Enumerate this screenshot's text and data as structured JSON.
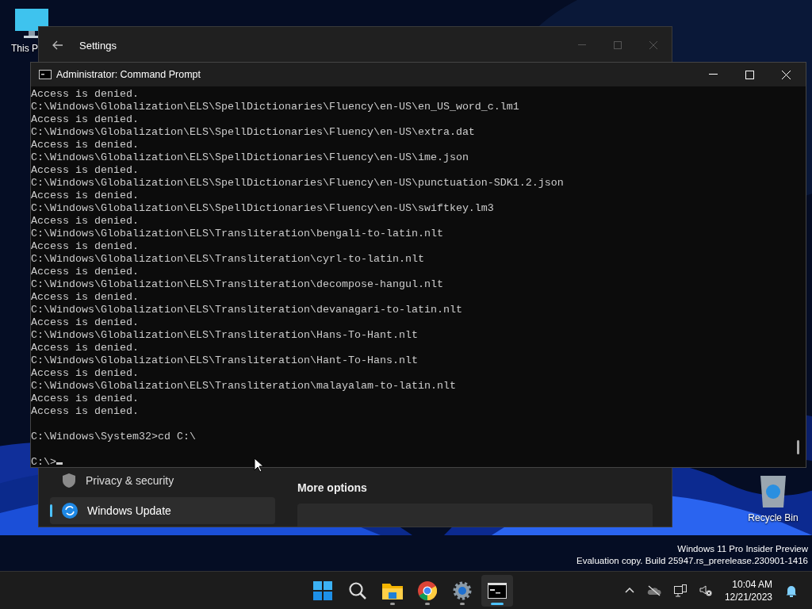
{
  "desktop_icons": [
    {
      "kind": "computer",
      "label": "This P"
    },
    {
      "kind": "recycle",
      "label": "Recycle Bin"
    }
  ],
  "settings_window": {
    "title": "Settings",
    "nav": [
      {
        "label": "Privacy & security",
        "kind": "shield",
        "selected": false
      },
      {
        "label": "Windows Update",
        "kind": "update",
        "selected": true
      }
    ],
    "section_heading": "More options"
  },
  "console_window": {
    "title": "Administrator: Command Prompt",
    "lines": [
      "Access is denied.",
      "C:\\Windows\\Globalization\\ELS\\SpellDictionaries\\Fluency\\en-US\\en_US_word_c.lm1",
      "Access is denied.",
      "C:\\Windows\\Globalization\\ELS\\SpellDictionaries\\Fluency\\en-US\\extra.dat",
      "Access is denied.",
      "C:\\Windows\\Globalization\\ELS\\SpellDictionaries\\Fluency\\en-US\\ime.json",
      "Access is denied.",
      "C:\\Windows\\Globalization\\ELS\\SpellDictionaries\\Fluency\\en-US\\punctuation-SDK1.2.json",
      "Access is denied.",
      "C:\\Windows\\Globalization\\ELS\\SpellDictionaries\\Fluency\\en-US\\swiftkey.lm3",
      "Access is denied.",
      "C:\\Windows\\Globalization\\ELS\\Transliteration\\bengali-to-latin.nlt",
      "Access is denied.",
      "C:\\Windows\\Globalization\\ELS\\Transliteration\\cyrl-to-latin.nlt",
      "Access is denied.",
      "C:\\Windows\\Globalization\\ELS\\Transliteration\\decompose-hangul.nlt",
      "Access is denied.",
      "C:\\Windows\\Globalization\\ELS\\Transliteration\\devanagari-to-latin.nlt",
      "Access is denied.",
      "C:\\Windows\\Globalization\\ELS\\Transliteration\\Hans-To-Hant.nlt",
      "Access is denied.",
      "C:\\Windows\\Globalization\\ELS\\Transliteration\\Hant-To-Hans.nlt",
      "Access is denied.",
      "C:\\Windows\\Globalization\\ELS\\Transliteration\\malayalam-to-latin.nlt",
      "Access is denied.",
      "Access is denied."
    ],
    "command": "C:\\Windows\\System32>cd C:\\",
    "prompt": "C:\\>"
  },
  "edition_notice": [
    "Windows 11 Pro Insider Preview",
    "Evaluation copy. Build 25947.rs_prerelease.230901-1416"
  ],
  "taskbar": {
    "apps": [
      {
        "kind": "start",
        "running": false,
        "active": false
      },
      {
        "kind": "search",
        "running": false,
        "active": false
      },
      {
        "kind": "folder",
        "running": true,
        "active": false
      },
      {
        "kind": "browser",
        "running": true,
        "active": false
      },
      {
        "kind": "gear",
        "running": true,
        "active": false
      },
      {
        "kind": "terminal",
        "running": true,
        "active": true
      }
    ],
    "time": "10:04 AM",
    "date": "12/21/2023"
  }
}
